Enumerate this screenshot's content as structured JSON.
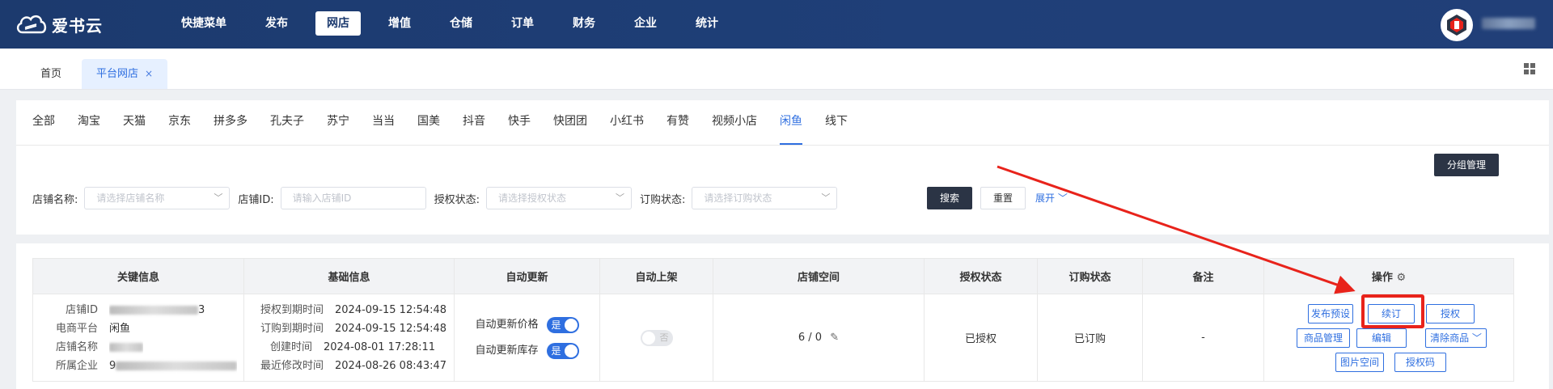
{
  "app": {
    "name": "爱书云"
  },
  "nav": {
    "items": [
      "快捷菜单",
      "发布",
      "网店",
      "增值",
      "仓储",
      "订单",
      "财务",
      "企业",
      "统计"
    ],
    "active": "网店"
  },
  "tabs": {
    "home": "首页",
    "active": "平台网店",
    "close": "×"
  },
  "platform_tabs": {
    "items": [
      "全部",
      "淘宝",
      "天猫",
      "京东",
      "拼多多",
      "孔夫子",
      "苏宁",
      "当当",
      "国美",
      "抖音",
      "快手",
      "快团团",
      "小红书",
      "有赞",
      "视频小店",
      "闲鱼",
      "线下"
    ],
    "active": "闲鱼"
  },
  "group_manage": "分组管理",
  "filters": {
    "shop_name": {
      "label": "店铺名称:",
      "placeholder": "请选择店铺名称"
    },
    "shop_id": {
      "label": "店铺ID:",
      "placeholder": "请输入店铺ID"
    },
    "auth_status": {
      "label": "授权状态:",
      "placeholder": "请选择授权状态"
    },
    "order_status": {
      "label": "订购状态:",
      "placeholder": "请选择订购状态"
    },
    "search": "搜索",
    "reset": "重置",
    "expand": "展开"
  },
  "table": {
    "headers": [
      "关键信息",
      "基础信息",
      "自动更新",
      "自动上架",
      "店铺空间",
      "授权状态",
      "订购状态",
      "备注",
      "操作"
    ],
    "row": {
      "key_info": [
        {
          "k": "店铺ID",
          "v": "3"
        },
        {
          "k": "电商平台",
          "v": "闲鱼"
        },
        {
          "k": "店铺名称",
          "v": ""
        },
        {
          "k": "所属企业",
          "v": "9"
        }
      ],
      "basic_info": [
        {
          "k": "授权到期时间",
          "v": "2024-09-15 12:54:48"
        },
        {
          "k": "订购到期时间",
          "v": "2024-09-15 12:54:48"
        },
        {
          "k": "创建时间",
          "v": "2024-08-01 17:28:11"
        },
        {
          "k": "最近修改时间",
          "v": "2024-08-26 08:43:47"
        }
      ],
      "auto_update": [
        {
          "label": "自动更新价格",
          "state": "是"
        },
        {
          "label": "自动更新库存",
          "state": "是"
        }
      ],
      "auto_shelf": "否",
      "space": "6 / 0",
      "auth_status": "已授权",
      "order_status": "已订购",
      "remark": "-",
      "actions": {
        "publish_preset": "发布预设",
        "renew": "续订",
        "authorize": "授权",
        "goods_manage": "商品管理",
        "edit": "编辑",
        "clear_goods": "清除商品",
        "image_space": "图片空间",
        "auth_code": "授权码"
      }
    }
  },
  "colors": {
    "topbar": "#1c3a6e",
    "primary": "#2f6fe0",
    "dark_button": "#2b3445",
    "annotation": "#e8231b"
  }
}
